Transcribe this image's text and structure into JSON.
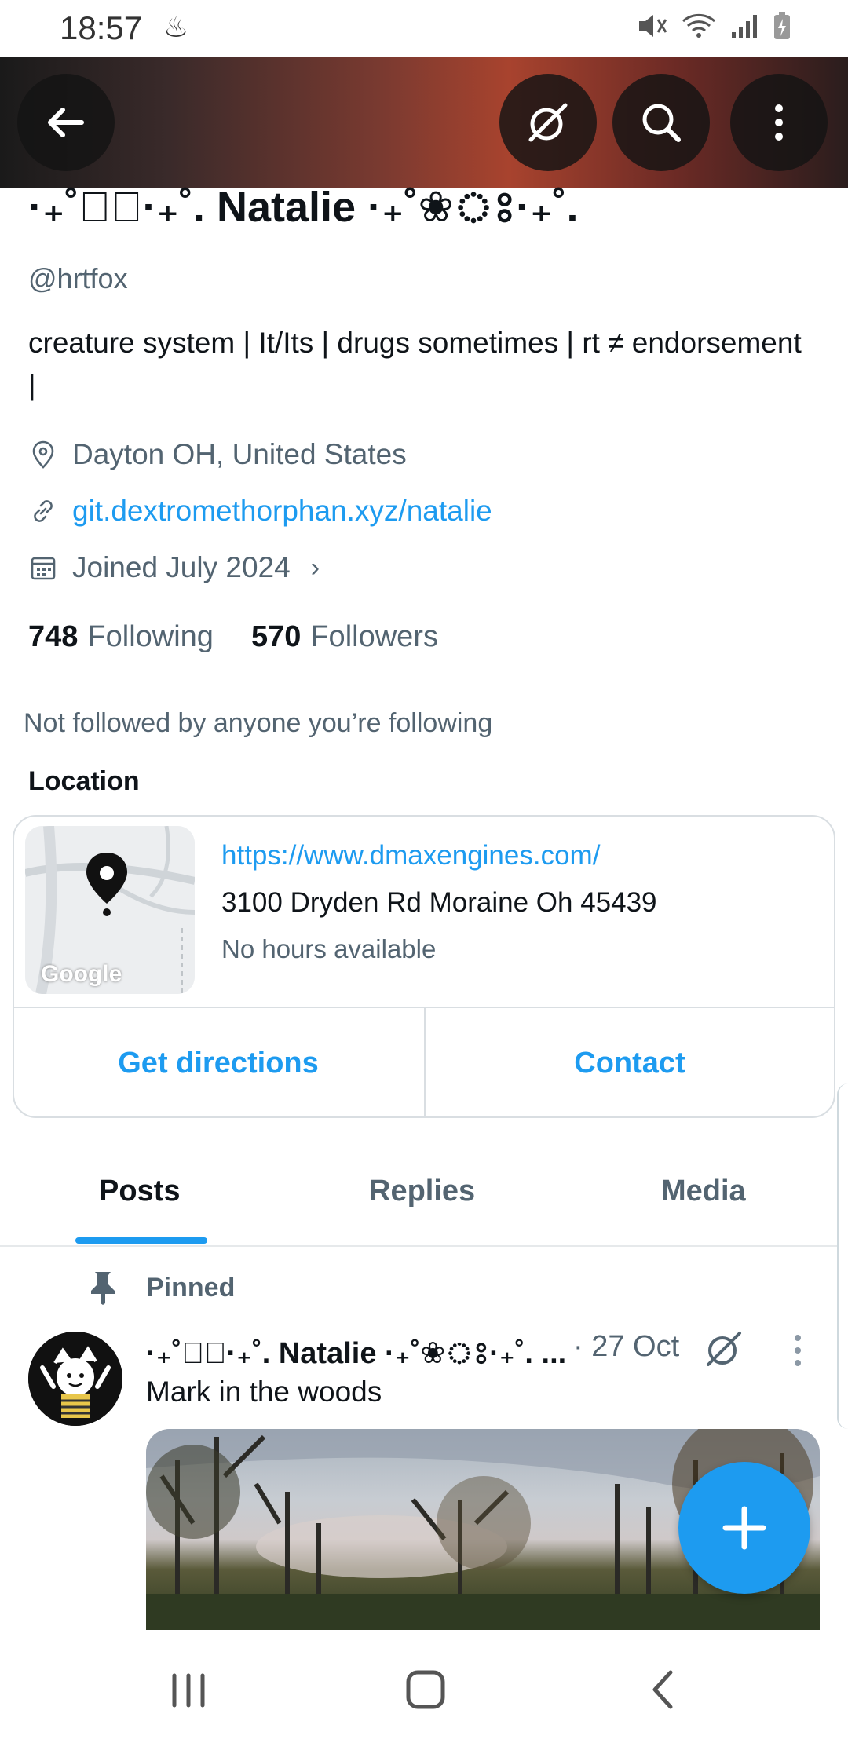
{
  "status_bar": {
    "time": "18:57",
    "extra": "♨"
  },
  "header": {
    "back_label": "Back",
    "grok_label": "Grok",
    "search_label": "Search",
    "more_label": "More options"
  },
  "profile": {
    "display_name": "·₊˚❀ঃ·₊˚. Natalie ·₊˚❀ঃ·₊˚.",
    "handle": "@hrtfox",
    "bio": "creature system | It/Its | drugs sometimes | rt ≠ endorsement |",
    "location": "Dayton OH, United States",
    "website": "git.dextromethorphan.xyz/natalie",
    "joined": "Joined July 2024",
    "following_count": "748",
    "following_label": "Following",
    "followers_count": "570",
    "followers_label": "Followers",
    "not_followed_text": "Not followed by anyone you’re following"
  },
  "location_card": {
    "title": "Location",
    "map_label": "Google",
    "url": "https://www.dmaxengines.com/",
    "address": "3100 Dryden Rd Moraine Oh 45439",
    "hours": "No hours available",
    "directions_label": "Get directions",
    "contact_label": "Contact"
  },
  "tabs": [
    {
      "label": "Posts",
      "active": true
    },
    {
      "label": "Replies",
      "active": false
    },
    {
      "label": "Media",
      "active": false
    }
  ],
  "post": {
    "pinned_label": "Pinned",
    "author": "·₊˚❀ঃ·₊˚. Natalie ·₊˚❀ঃ·₊˚. ...",
    "time": "· 27 Oct",
    "text": "Mark in the woods"
  },
  "colors": {
    "accent": "#1d9bf0",
    "text_primary": "#0f1419",
    "text_secondary": "#536471",
    "border": "#d9dee2"
  }
}
